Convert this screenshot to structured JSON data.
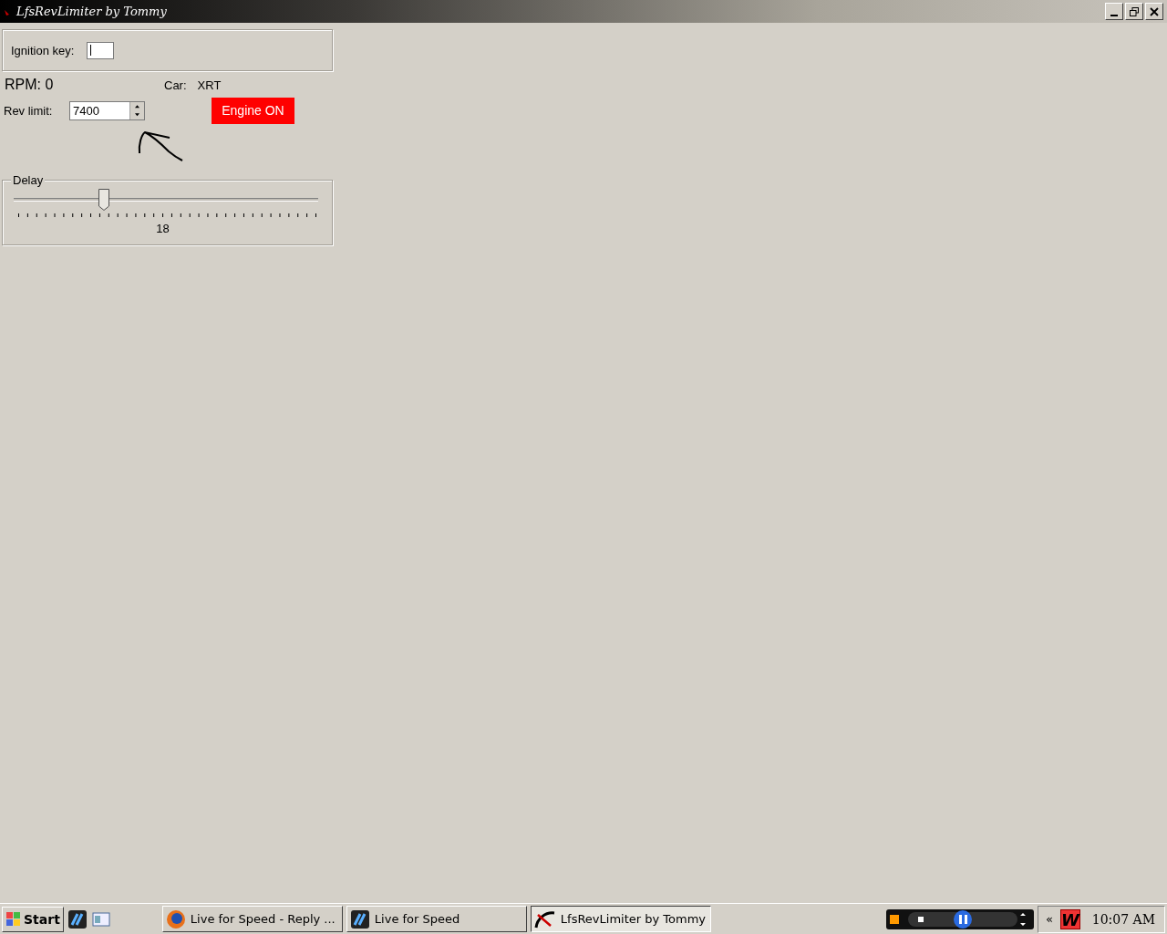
{
  "window": {
    "title": "LfsRevLimiter by Tommy"
  },
  "ignition": {
    "label": "Ignition key:",
    "focused": true
  },
  "rpm": "RPM: 0",
  "car": {
    "label": "Car:",
    "value": "XRT"
  },
  "rev_limit": {
    "label": "Rev limit:",
    "value": "7400"
  },
  "engine_button": {
    "label": "Engine ON",
    "on": true
  },
  "delay": {
    "title": "Delay",
    "level": 0.295,
    "value": "18"
  },
  "taskbar": {
    "start": "Start",
    "tasks": [
      {
        "label": "Live for Speed - Reply ...",
        "selected": false
      },
      {
        "label": "Live for Speed",
        "selected": false
      },
      {
        "label": "LfsRevLimiter by Tommy",
        "selected": true
      }
    ],
    "tray_expand": "«",
    "tray_logo": "W",
    "clock": "10:07 AM"
  }
}
